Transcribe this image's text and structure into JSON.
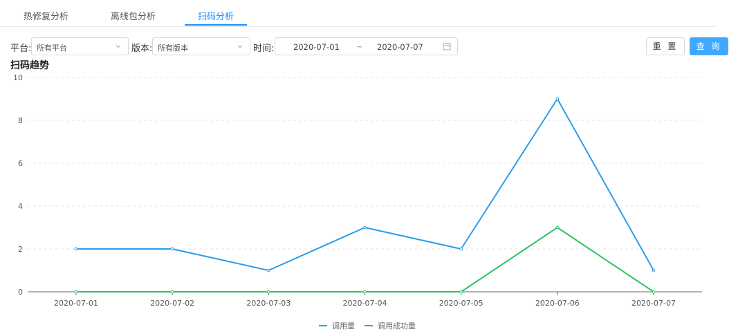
{
  "tabs": [
    {
      "label": "热修复分析",
      "active": false
    },
    {
      "label": "离线包分析",
      "active": false
    },
    {
      "label": "扫码分析",
      "active": true
    }
  ],
  "filters": {
    "platform_label": "平台:",
    "platform_value": "所有平台",
    "version_label": "版本:",
    "version_value": "所有版本",
    "time_label": "时间:",
    "date_start": "2020-07-01",
    "date_sep": "~",
    "date_end": "2020-07-07"
  },
  "buttons": {
    "reset": "重 置",
    "query": "查 询"
  },
  "colors": {
    "accent": "#1890ff",
    "series_call": "#2b9de8",
    "series_success": "#2ec26a"
  },
  "chart_title": "扫码趋势",
  "chart_data": {
    "type": "line",
    "categories": [
      "2020-07-01",
      "2020-07-02",
      "2020-07-03",
      "2020-07-04",
      "2020-07-05",
      "2020-07-06",
      "2020-07-07"
    ],
    "series": [
      {
        "name": "调用量",
        "values": [
          2,
          2,
          1,
          3,
          2,
          9,
          1
        ]
      },
      {
        "name": "调用成功量",
        "values": [
          0,
          0,
          0,
          0,
          0,
          3,
          0
        ]
      }
    ],
    "y_ticks": [
      0,
      2,
      4,
      6,
      8,
      10
    ],
    "ylim": [
      0,
      10
    ],
    "grid": true,
    "legend_position": "bottom"
  }
}
